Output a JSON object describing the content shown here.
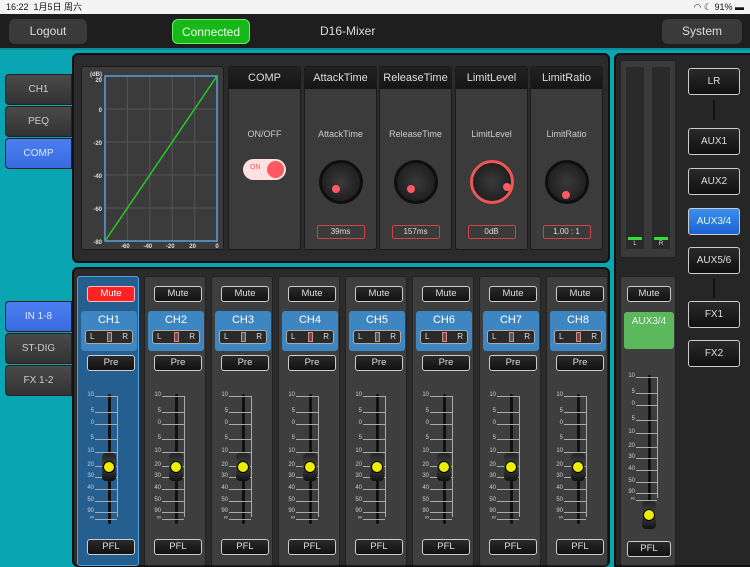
{
  "status": {
    "time": "16:22",
    "date": "1月5日 周六",
    "battery": "91%"
  },
  "nav": {
    "logout": "Logout",
    "connected": "Connected",
    "title": "D16-Mixer",
    "system": "System"
  },
  "tabs_top": [
    {
      "label": "CH1",
      "active": false
    },
    {
      "label": "PEQ",
      "active": false
    },
    {
      "label": "COMP",
      "active": true
    }
  ],
  "tabs_bottom": [
    {
      "label": "IN 1-8",
      "active": true
    },
    {
      "label": "ST-DIG",
      "active": false
    },
    {
      "label": "FX 1-2",
      "active": false
    }
  ],
  "comp": {
    "graph": {
      "unit": "(dB)",
      "y_ticks": [
        "20",
        "0",
        "-20",
        "-40",
        "-60",
        "-80"
      ],
      "x_ticks": [
        "-60",
        "-40",
        "-20",
        "20",
        "0"
      ],
      "line_color": "#22cc22"
    },
    "switch": {
      "header": "COMP",
      "label": "ON/OFF",
      "state": "ON"
    },
    "params": [
      {
        "header": "AttackTime",
        "label": "AttackTime",
        "value": "39ms"
      },
      {
        "header": "ReleaseTime",
        "label": "ReleaseTime",
        "value": "157ms"
      },
      {
        "header": "LimitLevel",
        "label": "LimitLevel",
        "value": "0dB"
      },
      {
        "header": "LimitRatio",
        "label": "LimitRatio",
        "value": "1.00 : 1"
      }
    ]
  },
  "scale": [
    "10",
    "5",
    "0",
    "5",
    "10",
    "20",
    "30",
    "40",
    "50",
    "90",
    "∞"
  ],
  "channels": [
    {
      "name": "CH1",
      "mute": "Mute",
      "muted": true,
      "pre": "Pre",
      "pfl": "PFL",
      "pan_l": "L",
      "pan_r": "R",
      "selected": true
    },
    {
      "name": "CH2",
      "mute": "Mute",
      "muted": false,
      "pre": "Pre",
      "pfl": "PFL",
      "pan_l": "L",
      "pan_r": "R"
    },
    {
      "name": "CH3",
      "mute": "Mute",
      "muted": false,
      "pre": "Pre",
      "pfl": "PFL",
      "pan_l": "L",
      "pan_r": "R"
    },
    {
      "name": "CH4",
      "mute": "Mute",
      "muted": false,
      "pre": "Pre",
      "pfl": "PFL",
      "pan_l": "L",
      "pan_r": "R"
    },
    {
      "name": "CH5",
      "mute": "Mute",
      "muted": false,
      "pre": "Pre",
      "pfl": "PFL",
      "pan_l": "L",
      "pan_r": "R"
    },
    {
      "name": "CH6",
      "mute": "Mute",
      "muted": false,
      "pre": "Pre",
      "pfl": "PFL",
      "pan_l": "L",
      "pan_r": "R"
    },
    {
      "name": "CH7",
      "mute": "Mute",
      "muted": false,
      "pre": "Pre",
      "pfl": "PFL",
      "pan_l": "L",
      "pan_r": "R"
    },
    {
      "name": "CH8",
      "mute": "Mute",
      "muted": false,
      "pre": "Pre",
      "pfl": "PFL",
      "pan_l": "L",
      "pan_r": "R"
    }
  ],
  "meter": {
    "l": "L",
    "r": "R"
  },
  "aux_strip": {
    "name": "AUX3/4",
    "mute": "Mute",
    "pfl": "PFL"
  },
  "outputs": [
    {
      "label": "LR"
    },
    {
      "label": "AUX1"
    },
    {
      "label": "AUX2"
    },
    {
      "label": "AUX3/4",
      "active": true
    },
    {
      "label": "AUX5/6"
    },
    {
      "label": "FX1"
    },
    {
      "label": "FX2"
    }
  ]
}
